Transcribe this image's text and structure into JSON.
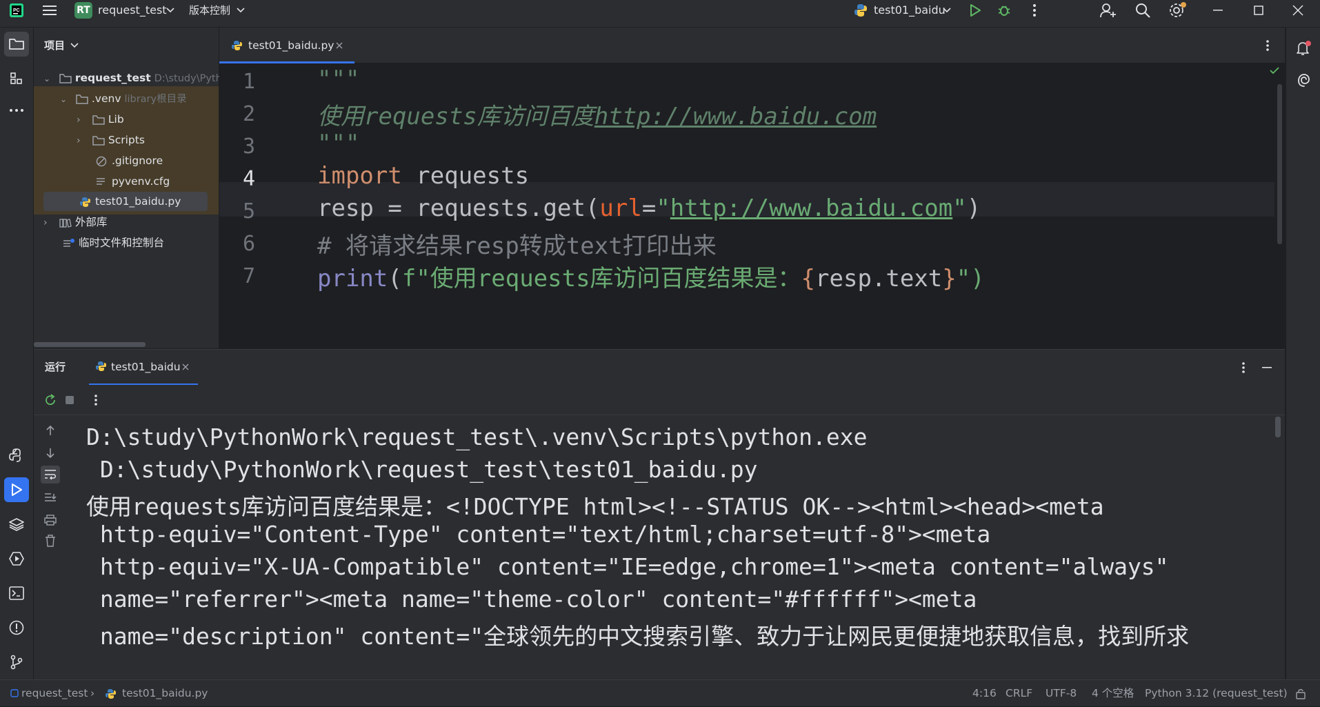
{
  "titlebar": {
    "project_badge": "RT",
    "project_name": "request_test",
    "vcs_menu": "版本控制",
    "run_config": "test01_baidu"
  },
  "project_panel": {
    "title": "项目",
    "tree": [
      {
        "label": "request_test",
        "hint": "D:\\study\\PythonWork\\request_test"
      },
      {
        "label": ".venv",
        "hint": "library根目录"
      },
      {
        "label": "Lib"
      },
      {
        "label": "Scripts"
      },
      {
        "label": ".gitignore"
      },
      {
        "label": "pyvenv.cfg"
      },
      {
        "label": "test01_baidu.py"
      },
      {
        "label": "外部库"
      },
      {
        "label": "临时文件和控制台"
      }
    ]
  },
  "editor": {
    "tab": "test01_baidu.py",
    "line_numbers": [
      "1",
      "2",
      "3",
      "4",
      "5",
      "6",
      "7"
    ],
    "lines": {
      "l1": "\"\"\"",
      "l2_text": "使用requests库访问百度",
      "l2_url": "http://www.baidu.com",
      "l3": "\"\"\"",
      "l4_kw": "import",
      "l4_rest": " requests",
      "l5_a": "resp = requests.get(",
      "l5_param": "url",
      "l5_eq": "=",
      "l5_q1": "\"",
      "l5_url": "http://www.baidu.com",
      "l5_q2": "\"",
      "l5_close": ")",
      "l6": "# 将请求结果resp转成text打印出来",
      "l7_print": "print",
      "l7_open": "(",
      "l7_str": "f\"使用requests库访问百度结果是：",
      "l7_lb": "{",
      "l7_expr": "resp.text",
      "l7_rb": "}",
      "l7_end": "\")"
    }
  },
  "run_panel": {
    "title": "运行",
    "tab": "test01_baidu",
    "output": [
      "D:\\study\\PythonWork\\request_test\\.venv\\Scripts\\python.exe",
      " D:\\study\\PythonWork\\request_test\\test01_baidu.py",
      "使用requests库访问百度结果是：<!DOCTYPE html><!--STATUS OK--><html><head><meta",
      " http-equiv=\"Content-Type\" content=\"text/html;charset=utf-8\"><meta",
      " http-equiv=\"X-UA-Compatible\" content=\"IE=edge,chrome=1\"><meta content=\"always\"",
      " name=\"referrer\"><meta name=\"theme-color\" content=\"#ffffff\"><meta",
      " name=\"description\" content=\"全球领先的中文搜索引擎、致力于让网民更便捷地获取信息，找到所求"
    ]
  },
  "statusbar": {
    "crumb_project": "request_test",
    "crumb_file": "test01_baidu.py",
    "position": "4:16",
    "line_sep": "CRLF",
    "encoding": "UTF-8",
    "indent": "4 个空格",
    "interpreter": "Python 3.12 (request_test)"
  },
  "colors": {
    "background": "#1e1f22",
    "panel": "#2b2d30",
    "accent": "#3574f0",
    "keyword": "#cf8e6d",
    "string": "#6aab73",
    "docstring": "#5f826b",
    "comment": "#7a7e85",
    "run_green": "#5fb865"
  },
  "icons": [
    "pycharm-logo-icon",
    "hamburger-menu-icon",
    "chevron-down-icon",
    "python-icon",
    "run-icon",
    "debug-icon",
    "more-vertical-icon",
    "add-user-icon",
    "search-icon",
    "settings-icon",
    "minimize-icon",
    "maximize-icon",
    "close-icon",
    "folder-icon",
    "structure-icon",
    "more-horizontal-icon",
    "python-console-icon",
    "run-tool-icon",
    "layers-icon",
    "services-icon",
    "terminal-icon",
    "problems-icon",
    "git-icon",
    "notifications-icon",
    "ai-assistant-icon",
    "rerun-icon",
    "stop-icon",
    "arrow-up-icon",
    "arrow-down-icon",
    "soft-wrap-icon",
    "scroll-end-icon",
    "print-icon",
    "trash-icon",
    "check-icon"
  ]
}
